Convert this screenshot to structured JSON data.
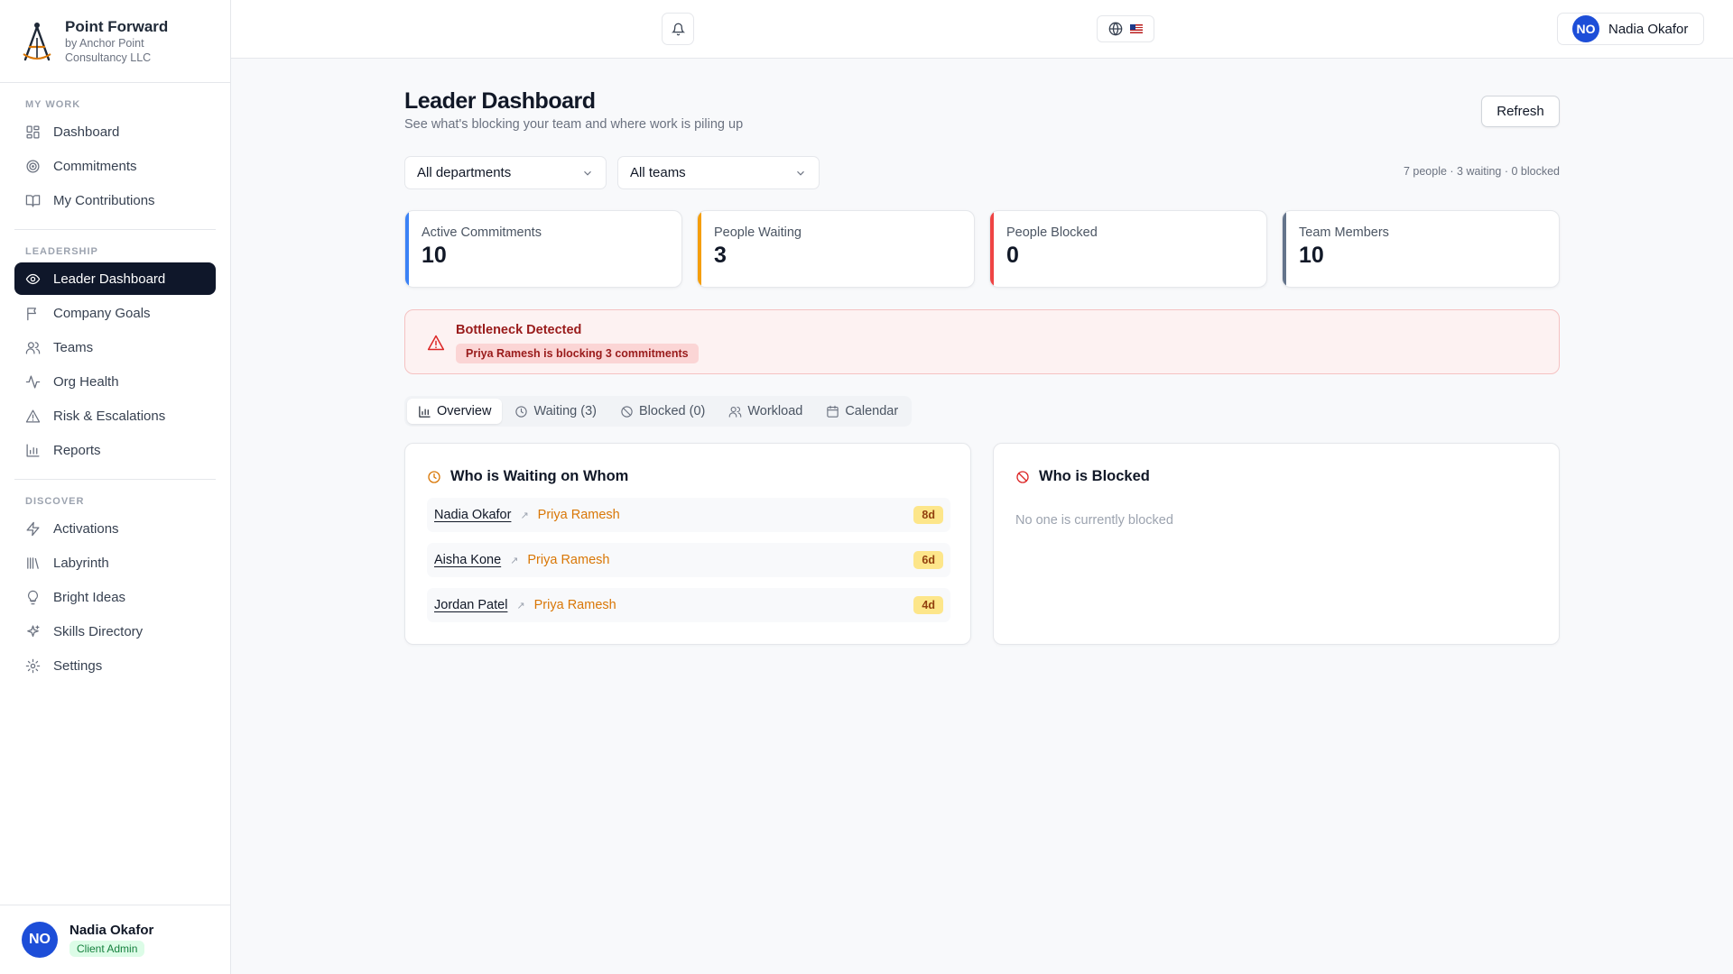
{
  "brand": {
    "title": "Point Forward",
    "sub_line1": "by Anchor Point",
    "sub_line2": "Consultancy LLC"
  },
  "sidebar": {
    "sections": [
      {
        "heading": "MY WORK",
        "items": [
          {
            "label": "Dashboard",
            "icon": "grid-icon"
          },
          {
            "label": "Commitments",
            "icon": "target-icon"
          },
          {
            "label": "My Contributions",
            "icon": "book-icon"
          }
        ]
      },
      {
        "heading": "LEADERSHIP",
        "items": [
          {
            "label": "Leader Dashboard",
            "icon": "eye-icon",
            "active": true
          },
          {
            "label": "Company Goals",
            "icon": "flag-icon"
          },
          {
            "label": "Teams",
            "icon": "users-icon"
          },
          {
            "label": "Org Health",
            "icon": "activity-icon"
          },
          {
            "label": "Risk & Escalations",
            "icon": "alert-triangle-icon"
          },
          {
            "label": "Reports",
            "icon": "bar-chart-icon"
          }
        ]
      },
      {
        "heading": "DISCOVER",
        "items": [
          {
            "label": "Activations",
            "icon": "zap-icon"
          },
          {
            "label": "Labyrinth",
            "icon": "library-icon"
          },
          {
            "label": "Bright Ideas",
            "icon": "lightbulb-icon"
          },
          {
            "label": "Skills Directory",
            "icon": "sparkles-icon"
          },
          {
            "label": "Settings",
            "icon": "gear-icon"
          }
        ]
      }
    ],
    "user": {
      "initials": "NO",
      "name": "Nadia Okafor",
      "role": "Client Admin"
    }
  },
  "topbar": {
    "user_initials": "NO",
    "user_name": "Nadia Okafor",
    "language_flag": "us-flag-icon"
  },
  "page": {
    "title": "Leader Dashboard",
    "subtitle": "See what's blocking your team and where work is piling up",
    "refresh_label": "Refresh",
    "department_filter": "All departments",
    "team_filter": "All teams",
    "summary": "7 people · 3 waiting · 0 blocked"
  },
  "stats": [
    {
      "label": "Active Commitments",
      "value": "10",
      "accent": "#3b82f6"
    },
    {
      "label": "People Waiting",
      "value": "3",
      "accent": "#f59e0b"
    },
    {
      "label": "People Blocked",
      "value": "0",
      "accent": "#ef4444"
    },
    {
      "label": "Team Members",
      "value": "10",
      "accent": "#64748b"
    }
  ],
  "alert": {
    "title": "Bottleneck Detected",
    "message": "Priya Ramesh is blocking 3 commitments"
  },
  "tabs": [
    {
      "label": "Overview",
      "icon": "bar-chart-icon",
      "active": true
    },
    {
      "label": "Waiting (3)",
      "icon": "clock-icon"
    },
    {
      "label": "Blocked (0)",
      "icon": "ban-icon"
    },
    {
      "label": "Workload",
      "icon": "users-icon"
    },
    {
      "label": "Calendar",
      "icon": "calendar-icon"
    }
  ],
  "waiting_panel": {
    "title": "Who is Waiting on Whom",
    "rows": [
      {
        "waiter": "Nadia Okafor",
        "blocker": "Priya Ramesh",
        "days": "8d"
      },
      {
        "waiter": "Aisha Kone",
        "blocker": "Priya Ramesh",
        "days": "6d"
      },
      {
        "waiter": "Jordan Patel",
        "blocker": "Priya Ramesh",
        "days": "4d"
      }
    ]
  },
  "blocked_panel": {
    "title": "Who is Blocked",
    "empty_text": "No one is currently blocked"
  }
}
